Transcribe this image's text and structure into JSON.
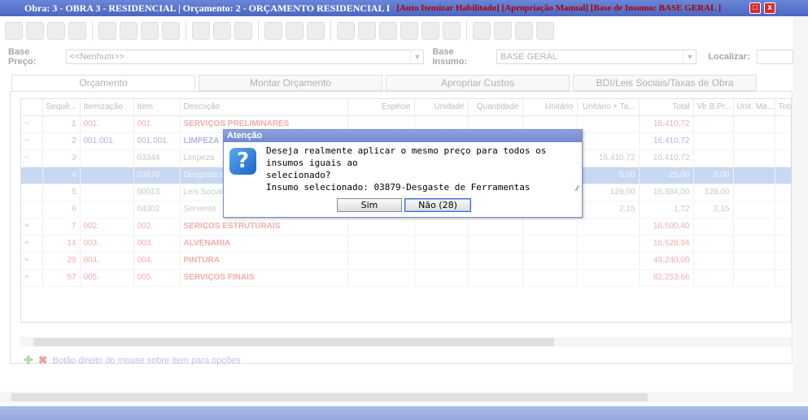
{
  "window": {
    "title": "Obra: 3 - OBRA 3 - RESIDENCIAL | Orçamento: 2 - ORÇAMENTO RESIDENCIAL I",
    "flags": "[Auto Itemizar Habilitado]   [Apropriação Manual]   [Base de Insumo: BASE GERAL ]",
    "close_glyph": "x",
    "restore_glyph": "□"
  },
  "filters": {
    "base_preco_label": "Base Preço:",
    "base_preco_value": "<<Nenhum>>",
    "base_insumo_label": "Base Insumo:",
    "base_insumo_value": "BASE GERAL",
    "localizar_label": "Localizar:"
  },
  "tabs": [
    "Orçamento",
    "Montar Orçamento",
    "Apropriar Custos",
    "BDI/Leis Sociais/Taxas de Obra"
  ],
  "grid": {
    "columns": [
      "Sequê...",
      "Itemização",
      "Item",
      "Descrição",
      "Espécie",
      "Unidade",
      "Quantidade",
      "Unitário",
      "Unitário + Ta...",
      "Total",
      "Vlr B.Pr...",
      "Unit. Ma...",
      "Tota"
    ],
    "rows": [
      {
        "exp": "−",
        "seq": "1",
        "itz": "001.",
        "item": "001.",
        "desc": "SERVIÇOS PRELIMINARES",
        "unit_ta": "",
        "total": "16.410,72",
        "vlr": "",
        "style": "red"
      },
      {
        "exp": "−",
        "seq": "2",
        "itz": "001.001.",
        "item": "001.001.",
        "desc": "LIMPEZA",
        "unit_ta": "",
        "total": "16.410,72",
        "vlr": "",
        "style": "blue"
      },
      {
        "exp": "−",
        "seq": "3",
        "itz": "",
        "item": "03344",
        "desc": "Limpeza",
        "unit_ta": "16.410,72",
        "total": "16.410,72",
        "vlr": "",
        "style": "plain"
      },
      {
        "exp": "",
        "seq": "4",
        "itz": "",
        "item": "03879",
        "desc": "Desgaste d",
        "unit_ta": "5,00",
        "total": "25,00",
        "vlr": "5,00",
        "style": "sel"
      },
      {
        "exp": "",
        "seq": "5",
        "itz": "",
        "item": "00013",
        "desc": "Leis Sociai",
        "unit_ta": "128,00",
        "total": "16.384,00",
        "vlr": "128,00",
        "style": "green"
      },
      {
        "exp": "",
        "seq": "6",
        "itz": "",
        "item": "04302",
        "desc": "Servente",
        "unit_ta": "2,15",
        "total": "1,72",
        "vlr": "2,15",
        "style": "plain"
      },
      {
        "exp": "+",
        "seq": "7",
        "itz": "002.",
        "item": "002.",
        "desc": "SERIÇOS ESTRUTURAIS",
        "unit_ta": "",
        "total": "16.500,40",
        "vlr": "",
        "style": "red"
      },
      {
        "exp": "+",
        "seq": "14",
        "itz": "003.",
        "item": "003.",
        "desc": "ALVENARIA",
        "unit_ta": "",
        "total": "16.528,94",
        "vlr": "",
        "style": "red"
      },
      {
        "exp": "+",
        "seq": "29",
        "itz": "004.",
        "item": "004.",
        "desc": "PINTURA",
        "unit_ta": "",
        "total": "49.240,00",
        "vlr": "",
        "style": "red"
      },
      {
        "exp": "+",
        "seq": "57",
        "itz": "005.",
        "item": "005.",
        "desc": "SERVIÇOS FINAIS",
        "unit_ta": "",
        "total": "82.253,66",
        "vlr": "",
        "style": "red"
      }
    ]
  },
  "footer_hint": "Botão direito do mouse sobre item para opções",
  "dialog": {
    "title": "Atenção",
    "icon": "?",
    "line1": "Deseja realmente aplicar o mesmo preço para todos os insumos iguais ao",
    "line2": "selecionado?",
    "line3": "Insumo selecionado: 03879-Desgaste de Ferramentas",
    "yes_label": "Sim",
    "no_label": "Não (28)"
  }
}
